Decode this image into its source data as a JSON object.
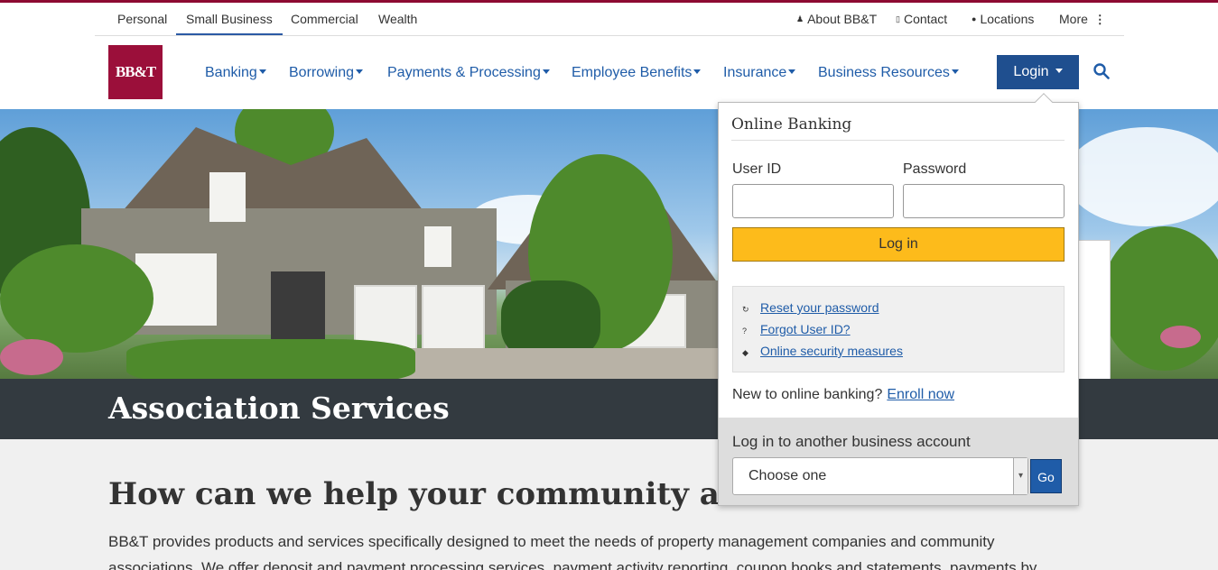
{
  "utility_nav": {
    "segments": [
      "Personal",
      "Small Business",
      "Commercial",
      "Wealth"
    ],
    "about": "About BB&T",
    "contact": "Contact",
    "locations": "Locations",
    "more": "More"
  },
  "logo": {
    "text": "BB&T"
  },
  "main_nav": {
    "items": [
      "Banking",
      "Borrowing",
      "Payments & Processing",
      "Employee Benefits",
      "Insurance",
      "Business Resources"
    ],
    "login": "Login"
  },
  "hero": {
    "title": "Association Services"
  },
  "content": {
    "heading": "How can we help your community association?",
    "paragraph_line1": "BB&T provides products and services specifically designed to meet the needs of property management companies and community",
    "paragraph_line2": "associations. We offer deposit and payment processing services, payment activity reporting, coupon books and statements, payments by"
  },
  "login_dropdown": {
    "title": "Online Banking",
    "user_id_label": "User ID",
    "password_label": "Password",
    "submit": "Log in",
    "links": [
      "Reset your password",
      "Forgot User ID?",
      "Online security measures"
    ],
    "new_prompt": "New to online banking?",
    "enroll": "Enroll now",
    "another_label": "Log in to another business account",
    "select_value": "Choose one",
    "go": "Go"
  },
  "colors": {
    "brand": "#9b0f3a",
    "link": "#1f5ca8",
    "login_button": "#1f4f8f",
    "submit": "#fdbb1b"
  }
}
